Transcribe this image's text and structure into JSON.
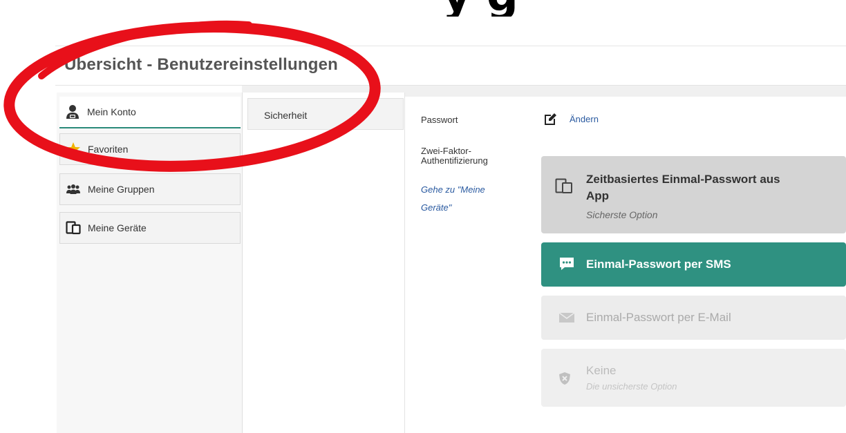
{
  "heading_fragment": "y       g",
  "page_title": "Übersicht - Benutzereinstellungen",
  "nav": {
    "items": [
      {
        "label": "Mein Konto",
        "icon": "user-icon"
      },
      {
        "label": "Favoriten",
        "icon": "star-icon"
      },
      {
        "label": "Meine Gruppen",
        "icon": "group-icon"
      },
      {
        "label": "Meine Geräte",
        "icon": "devices-icon"
      }
    ]
  },
  "mid_tab": "Sicherheit",
  "content": {
    "password_label": "Passwort",
    "change_link": "Ändern",
    "twofa_label_1": "Zwei-Faktor-",
    "twofa_label_2": "Authentifizierung",
    "goto_link_1": "Gehe zu \"Meine",
    "goto_link_2": "Geräte\""
  },
  "options": [
    {
      "title_1": "Zeitbasiertes Einmal-Passwort aus",
      "title_2": "App",
      "subtitle": "Sicherste Option",
      "icon": "devices-icon"
    },
    {
      "title": "Einmal-Passwort per SMS",
      "icon": "sms-icon",
      "state": "selected"
    },
    {
      "title": "Einmal-Passwort per E-Mail",
      "icon": "envelope-icon",
      "state": "disabled"
    },
    {
      "title": "Keine",
      "subtitle": "Die unsicherste Option",
      "icon": "shield-x-icon",
      "state": "disabled"
    }
  ],
  "colors": {
    "accent": "#2f9181",
    "annotation": "#e8101a",
    "link": "#2a5aa0"
  }
}
